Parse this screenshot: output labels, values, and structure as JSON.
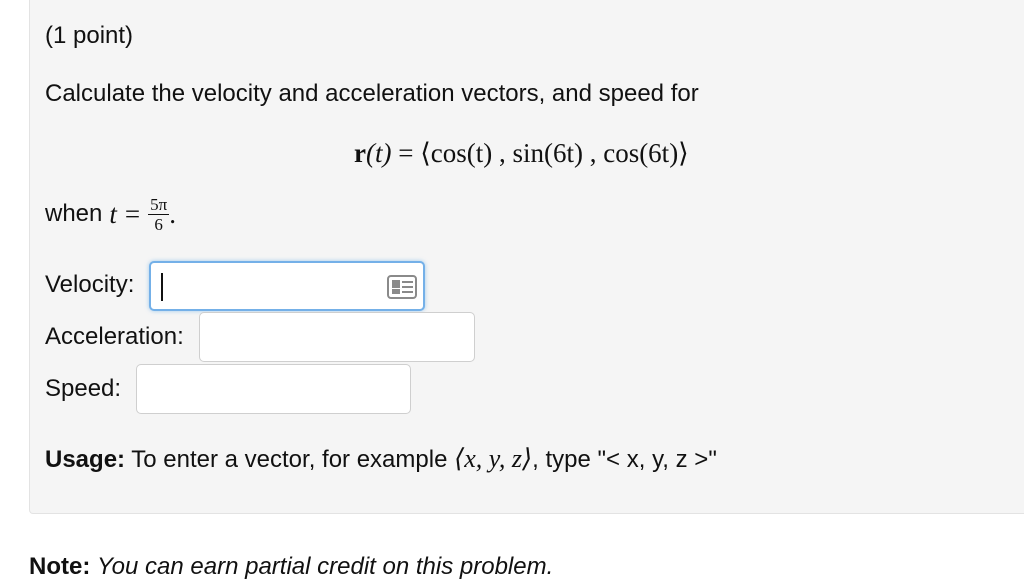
{
  "problem": {
    "points": "(1 point)",
    "statement": "Calculate the velocity and acceleration vectors, and speed for",
    "formula": {
      "lhs_func": "r",
      "lhs_arg": "(t)",
      "equals": "=",
      "rhs": "⟨cos(t) , sin(6t) , cos(6t)⟩"
    },
    "when": {
      "prefix": "when",
      "var": "t",
      "equals": "=",
      "num": "5π",
      "den": "6",
      "suffix": "."
    }
  },
  "fields": {
    "velocity": {
      "label": "Velocity:",
      "value": ""
    },
    "acceleration": {
      "label": "Acceleration:",
      "value": ""
    },
    "speed": {
      "label": "Speed:",
      "value": ""
    }
  },
  "usage": {
    "bold": "Usage:",
    "text1": "To enter a vector, for example",
    "example": "⟨x, y, z⟩",
    "text2": ", type \"< x, y, z >\""
  },
  "note": {
    "bold": "Note:",
    "text": "You can earn partial credit on this problem."
  },
  "icons": {
    "equation_editor": "equation-editor-card-icon"
  },
  "colors": {
    "focus_border": "#74b0e8",
    "panel_background": "#f5f5f5"
  }
}
